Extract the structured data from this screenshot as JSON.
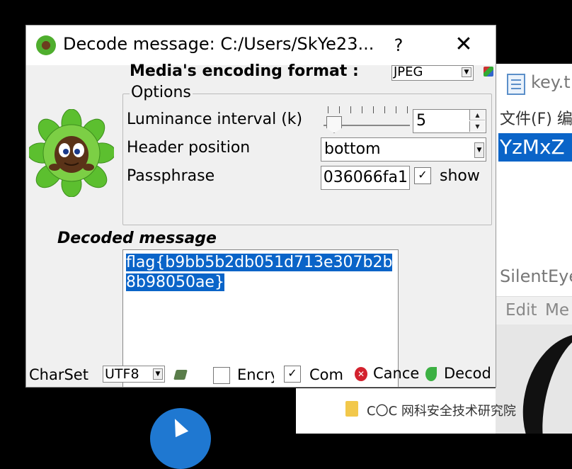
{
  "background": {
    "key_window": {
      "title": "key.t",
      "menu": "文件(F)  编",
      "selected_text": "YzMxZ"
    },
    "silenteye_window": {
      "title": "SilentEye",
      "menu_items": [
        "Edit",
        "Me"
      ]
    },
    "watermark": "C〇C 网科安全技术研究院"
  },
  "dialog": {
    "title": "Decode message: C:/Users/SkYe23...",
    "help": "?",
    "close": "✕",
    "encoding_label": "Media's encoding format :",
    "encoding_value": "JPEG",
    "options_legend": "Options",
    "luminance_label": "Luminance interval (k)",
    "luminance_value": "5",
    "header_label": "Header position",
    "header_value": "bottom",
    "passphrase_label": "Passphrase",
    "passphrase_value": "036066fa1",
    "show_label": "show",
    "show_checked": "✓",
    "decoded_label": "Decoded message",
    "decoded_message": "flag{b9bb5b2db051d713e307b2b8b98050ae}",
    "charset_label": "CharSet",
    "charset_value": "UTF8",
    "encrypt_label": "Encry",
    "compress_label": "Com",
    "compress_checked": "✓",
    "cancel_label": "Cance",
    "decode_label": "Decod"
  },
  "colors": {
    "selection": "#0a64c8",
    "dialog_bg": "#f0f0f0",
    "taskbar_circle": "#1f78d1"
  }
}
